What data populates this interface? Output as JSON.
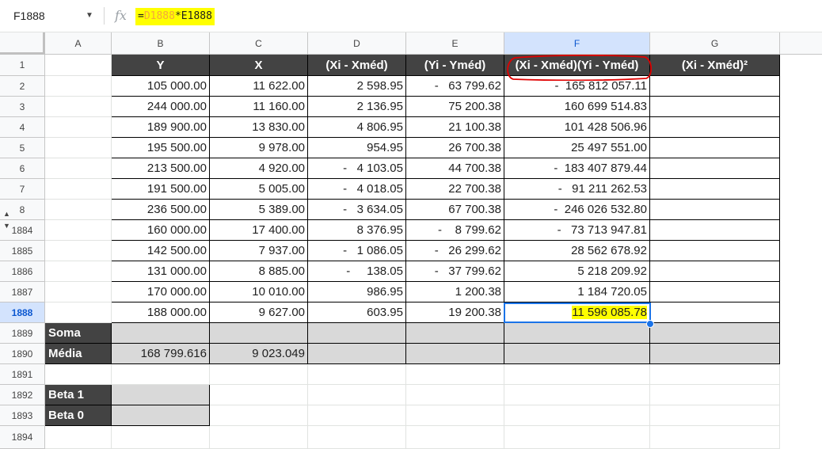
{
  "formula_bar": {
    "cell_ref": "F1888",
    "fx": "fx",
    "formula_prefix": "=",
    "formula_ref1": "D1888",
    "formula_op": "*",
    "formula_ref2": "E1888"
  },
  "columns": [
    "A",
    "B",
    "C",
    "D",
    "E",
    "F",
    "G"
  ],
  "row_numbers": [
    "1",
    "2",
    "3",
    "4",
    "5",
    "6",
    "7",
    "8",
    "1884",
    "1885",
    "1886",
    "1887",
    "1888",
    "1889",
    "1890",
    "1891",
    "1892",
    "1893",
    "1894"
  ],
  "headers": [
    "Y",
    "X",
    "(Xi - Xméd)",
    "(Yi - Yméd)",
    "(Xi - Xméd)(Yi - Yméd)",
    "(Xi - Xméd)²"
  ],
  "rows": [
    [
      "105 000.00",
      "11 622.00",
      "2 598.95",
      "-   63 799.62",
      "-  165 812 057.11"
    ],
    [
      "244 000.00",
      "11 160.00",
      "2 136.95",
      "75 200.38",
      "160 699 514.83"
    ],
    [
      "189 900.00",
      "13 830.00",
      "4 806.95",
      "21 100.38",
      "101 428 506.96"
    ],
    [
      "195 500.00",
      "9 978.00",
      "954.95",
      "26 700.38",
      "25 497 551.00"
    ],
    [
      "213 500.00",
      "4 920.00",
      "-   4 103.05",
      "44 700.38",
      "-  183 407 879.44"
    ],
    [
      "191 500.00",
      "5 005.00",
      "-   4 018.05",
      "22 700.38",
      "-   91 211 262.53"
    ],
    [
      "236 500.00",
      "5 389.00",
      "-   3 634.05",
      "67 700.38",
      "-  246 026 532.80"
    ],
    [
      "160 000.00",
      "17 400.00",
      "8 376.95",
      "-    8 799.62",
      "-   73 713 947.81"
    ],
    [
      "142 500.00",
      "7 937.00",
      "-   1 086.05",
      "-   26 299.62",
      "28 562 678.92"
    ],
    [
      "131 000.00",
      "8 885.00",
      "-     138.05",
      "-   37 799.62",
      "5 218 209.92"
    ],
    [
      "170 000.00",
      "10 010.00",
      "986.95",
      "1 200.38",
      "1 184 720.05"
    ],
    [
      "188 000.00",
      "9 627.00",
      "603.95",
      "19 200.38",
      "11 596 085.78"
    ]
  ],
  "soma_label": "Soma",
  "media_label": "Média",
  "media_values": [
    "168 799.616",
    "9 023.049"
  ],
  "beta1_label": "Beta 1",
  "beta0_label": "Beta 0",
  "colors": {
    "header_bg": "#434343",
    "highlight": "#ffff00",
    "selection": "#1a73e8",
    "annotation": "#e00000"
  }
}
